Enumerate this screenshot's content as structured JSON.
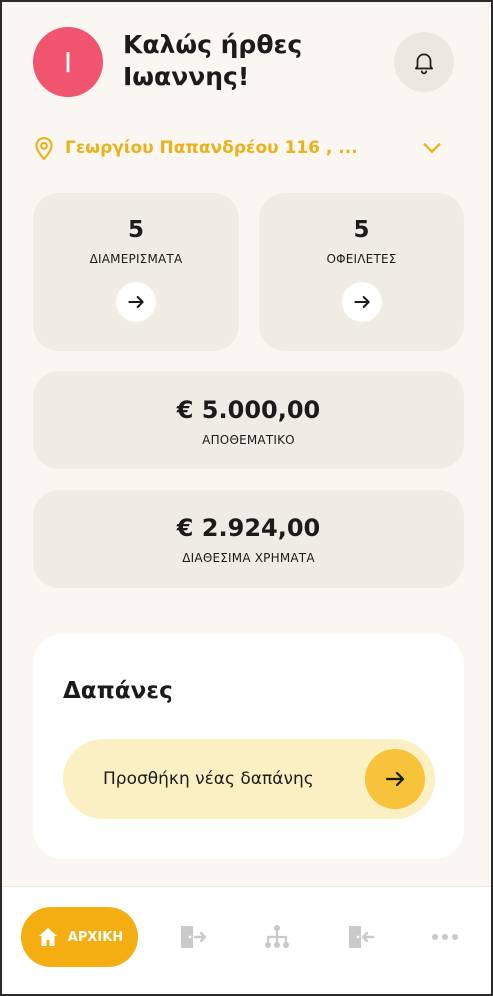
{
  "header": {
    "avatar_initial": "I",
    "greeting_line1": "Καλώς ήρθες",
    "greeting_line2": "Ιωαννης!",
    "bell_icon": "bell-icon"
  },
  "address": {
    "text": "Γεωργίου Παπανδρέου 116 , ...",
    "pin_icon": "map-pin-icon",
    "chevron_icon": "chevron-down-icon"
  },
  "stats": {
    "apartments": {
      "value": "5",
      "label": "ΔΙΑΜΕΡΙΣΜΑΤΑ"
    },
    "debtors": {
      "value": "5",
      "label": "ΟΦΕΙΛΕΤΕΣ"
    },
    "reserve": {
      "value": "€ 5.000,00",
      "label": "ΑΠΟΘΕΜΑΤΙΚΟ"
    },
    "available": {
      "value": "€ 2.924,00",
      "label": "ΔΙΑΘΕΣΙΜΑ ΧΡΗΜΑΤΑ"
    }
  },
  "expenses": {
    "title": "Δαπάνες",
    "add_label": "Προσθήκη νέας δαπάνης"
  },
  "bottom_nav": {
    "home_label": "ΑΡΧΙΚΗ",
    "items": [
      "home-icon",
      "door-enter-icon",
      "hierarchy-icon",
      "door-exit-icon",
      "more-icon"
    ]
  },
  "colors": {
    "accent": "#f4ae12",
    "accent_light": "#f6c33a",
    "address": "#e9b21b",
    "avatar": "#f0546e",
    "background": "#faf7f2",
    "card": "#efebe5"
  }
}
